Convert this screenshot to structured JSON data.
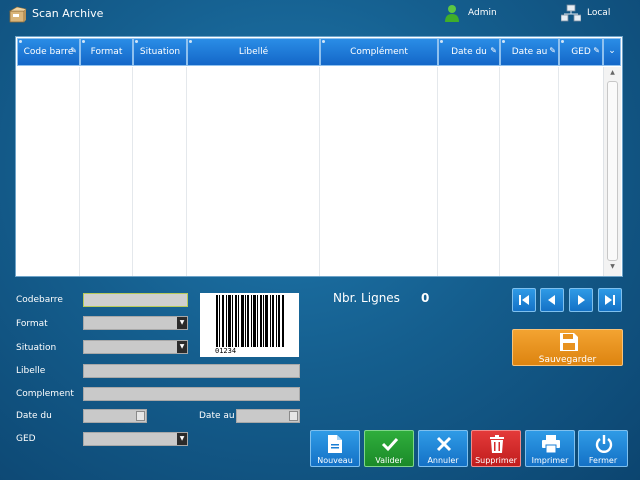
{
  "window": {
    "title": "Scan Archive",
    "user": "Admin",
    "location": "Local"
  },
  "grid": {
    "columns": [
      "Code barre",
      "Format",
      "Situation",
      "Libellé",
      "Complément",
      "Date du",
      "Date au",
      "GED"
    ],
    "rows": []
  },
  "form": {
    "codebarre_label": "Codebarre",
    "codebarre_value": "",
    "format_label": "Format",
    "format_value": "",
    "situation_label": "Situation",
    "situation_value": "",
    "libelle_label": "Libelle",
    "libelle_value": "",
    "complement_label": "Complement",
    "complement_value": "",
    "date_du_label": "Date du",
    "date_du_value": "",
    "date_au_label": "Date au",
    "date_au_value": "",
    "ged_label": "GED",
    "ged_value": ""
  },
  "barcode": {
    "number": "01234"
  },
  "summary": {
    "nbr_lignes_label": "Nbr. Lignes",
    "nbr_lignes_value": "0"
  },
  "buttons": {
    "save": "Sauvegarder",
    "new": "Nouveau",
    "validate": "Valider",
    "cancel": "Annuler",
    "delete": "Supprimer",
    "print": "Imprimer",
    "close": "Fermer"
  },
  "icons": {
    "app": "scanner-box-icon",
    "user": "user-icon",
    "network": "network-icon",
    "first": "first-page-icon",
    "prev": "previous-icon",
    "next": "next-icon",
    "last": "last-page-icon",
    "save": "floppy-disk-icon",
    "new": "document-icon",
    "validate": "check-icon",
    "cancel": "cross-icon",
    "delete": "trash-icon",
    "print": "printer-icon",
    "close": "power-icon"
  },
  "colors": {
    "background": "#155f8f",
    "header": "#1e7ad6",
    "save": "#e8921f",
    "validate": "#24a033",
    "delete": "#d42b2b"
  }
}
